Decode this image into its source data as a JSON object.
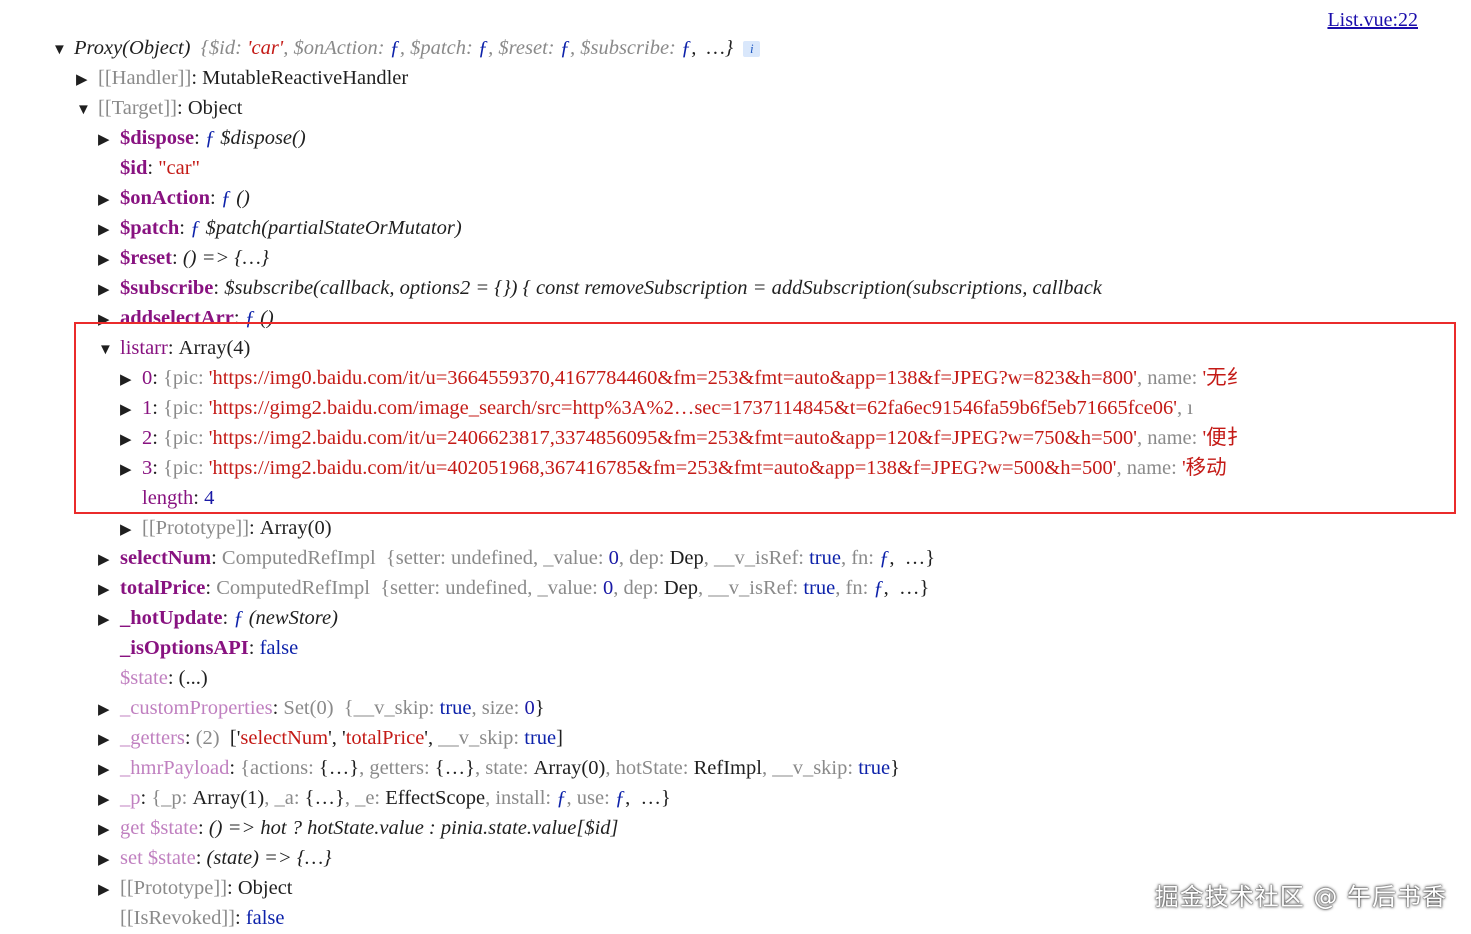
{
  "source_link": "List.vue:22",
  "lines": [
    {
      "caret": "down",
      "parts": [
        {
          "t": "Proxy(Object)",
          "c": "it"
        },
        {
          "t": "  "
        },
        {
          "t": "{$id: ",
          "c": "dim it"
        },
        {
          "t": "'car'",
          "c": "str it"
        },
        {
          "t": ", $onAction: ",
          "c": "dim it"
        },
        {
          "t": "ƒ",
          "c": "fn"
        },
        {
          "t": ", $patch: ",
          "c": "dim it"
        },
        {
          "t": "ƒ",
          "c": "fn"
        },
        {
          "t": ", $reset: ",
          "c": "dim it"
        },
        {
          "t": "ƒ",
          "c": "fn"
        },
        {
          "t": ", $subscribe: ",
          "c": "dim it"
        },
        {
          "t": "ƒ",
          "c": "fn"
        },
        {
          "t": ",  …}",
          "c": "it"
        }
      ],
      "badge": "i"
    },
    {
      "caret": "right",
      "parts": [
        {
          "t": "[[Handler]]",
          "c": "dim"
        },
        {
          "t": ": MutableReactiveHandler"
        }
      ]
    },
    {
      "caret": "down",
      "parts": [
        {
          "t": "[[Target]]",
          "c": "dim"
        },
        {
          "t": ": Object"
        }
      ]
    },
    {
      "caret": "right",
      "parts": [
        {
          "t": "$dispose",
          "c": "key"
        },
        {
          "t": ": "
        },
        {
          "t": "ƒ",
          "c": "fn"
        },
        {
          "t": " $dispose()",
          "c": "it"
        }
      ]
    },
    {
      "caret": "none",
      "parts": [
        {
          "t": "$id",
          "c": "key"
        },
        {
          "t": ": "
        },
        {
          "t": "\"car\"",
          "c": "str"
        }
      ]
    },
    {
      "caret": "right",
      "parts": [
        {
          "t": "$onAction",
          "c": "key"
        },
        {
          "t": ": "
        },
        {
          "t": "ƒ",
          "c": "fn"
        },
        {
          "t": " ()",
          "c": "it"
        }
      ]
    },
    {
      "caret": "right",
      "parts": [
        {
          "t": "$patch",
          "c": "key"
        },
        {
          "t": ": "
        },
        {
          "t": "ƒ",
          "c": "fn"
        },
        {
          "t": " $patch(partialStateOrMutator)",
          "c": "it"
        }
      ]
    },
    {
      "caret": "right",
      "parts": [
        {
          "t": "$reset",
          "c": "key"
        },
        {
          "t": ": "
        },
        {
          "t": "() => {…}",
          "c": "it"
        }
      ]
    },
    {
      "caret": "right",
      "parts": [
        {
          "t": "$subscribe",
          "c": "key"
        },
        {
          "t": ": "
        },
        {
          "t": "$subscribe(callback, options2 = {}) { const removeSubscription = addSubscription(subscriptions, callback",
          "c": "it"
        }
      ]
    },
    {
      "caret": "right",
      "parts": [
        {
          "t": "addselectArr",
          "c": "key"
        },
        {
          "t": ": "
        },
        {
          "t": "ƒ",
          "c": "fn"
        },
        {
          "t": " ()",
          "c": "it"
        }
      ]
    },
    {
      "caret": "down",
      "parts": [
        {
          "t": "listarr",
          "c": "keyp"
        },
        {
          "t": ": Array(4)"
        }
      ]
    },
    {
      "caret": "right",
      "parts": [
        {
          "t": "0",
          "c": "keyp"
        },
        {
          "t": ": "
        },
        {
          "t": "{pic: ",
          "c": "dim"
        },
        {
          "t": "'https://img0.baidu.com/it/u=3664559370,4167784460&fm=253&fmt=auto&app=138&f=JPEG?w=823&h=800'",
          "c": "str"
        },
        {
          "t": ", name: ",
          "c": "dim"
        },
        {
          "t": "'无纟",
          "c": "str"
        }
      ]
    },
    {
      "caret": "right",
      "parts": [
        {
          "t": "1",
          "c": "keyp"
        },
        {
          "t": ": "
        },
        {
          "t": "{pic: ",
          "c": "dim"
        },
        {
          "t": "'https://gimg2.baidu.com/image_search/src=http%3A%2…sec=1737114845&t=62fa6ec91546fa59b6f5eb71665fce06'",
          "c": "str"
        },
        {
          "t": ", ı",
          "c": "dim"
        }
      ]
    },
    {
      "caret": "right",
      "parts": [
        {
          "t": "2",
          "c": "keyp"
        },
        {
          "t": ": "
        },
        {
          "t": "{pic: ",
          "c": "dim"
        },
        {
          "t": "'https://img2.baidu.com/it/u=2406623817,3374856095&fm=253&fmt=auto&app=120&f=JPEG?w=750&h=500'",
          "c": "str"
        },
        {
          "t": ", name: ",
          "c": "dim"
        },
        {
          "t": "'便扌",
          "c": "str"
        }
      ]
    },
    {
      "caret": "right",
      "parts": [
        {
          "t": "3",
          "c": "keyp"
        },
        {
          "t": ": "
        },
        {
          "t": "{pic: ",
          "c": "dim"
        },
        {
          "t": "'https://img2.baidu.com/it/u=402051968,367416785&fm=253&fmt=auto&app=138&f=JPEG?w=500&h=500'",
          "c": "str"
        },
        {
          "t": ", name: ",
          "c": "dim"
        },
        {
          "t": "'移动",
          "c": "str"
        }
      ]
    },
    {
      "caret": "none",
      "parts": [
        {
          "t": "length",
          "c": "keyp"
        },
        {
          "t": ": "
        },
        {
          "t": "4",
          "c": "num"
        }
      ]
    },
    {
      "caret": "right",
      "parts": [
        {
          "t": "[[Prototype]]",
          "c": "dim"
        },
        {
          "t": ": Array(0)"
        }
      ]
    },
    {
      "caret": "right",
      "parts": [
        {
          "t": "selectNum",
          "c": "key"
        },
        {
          "t": ": "
        },
        {
          "t": "ComputedRefImpl",
          "c": "dim"
        },
        {
          "t": "  "
        },
        {
          "t": "{setter: ",
          "c": "dim"
        },
        {
          "t": "undefined",
          "c": "dim"
        },
        {
          "t": ", _value: ",
          "c": "dim"
        },
        {
          "t": "0",
          "c": "num"
        },
        {
          "t": ", dep: ",
          "c": "dim"
        },
        {
          "t": "Dep"
        },
        {
          "t": ", __v_isRef: ",
          "c": "dim"
        },
        {
          "t": "true",
          "c": "kw"
        },
        {
          "t": ", fn: ",
          "c": "dim"
        },
        {
          "t": "ƒ",
          "c": "fn"
        },
        {
          "t": ",  …}"
        }
      ]
    },
    {
      "caret": "right",
      "parts": [
        {
          "t": "totalPrice",
          "c": "key"
        },
        {
          "t": ": "
        },
        {
          "t": "ComputedRefImpl",
          "c": "dim"
        },
        {
          "t": "  "
        },
        {
          "t": "{setter: ",
          "c": "dim"
        },
        {
          "t": "undefined",
          "c": "dim"
        },
        {
          "t": ", _value: ",
          "c": "dim"
        },
        {
          "t": "0",
          "c": "num"
        },
        {
          "t": ", dep: ",
          "c": "dim"
        },
        {
          "t": "Dep"
        },
        {
          "t": ", __v_isRef: ",
          "c": "dim"
        },
        {
          "t": "true",
          "c": "kw"
        },
        {
          "t": ", fn: ",
          "c": "dim"
        },
        {
          "t": "ƒ",
          "c": "fn"
        },
        {
          "t": ",  …}"
        }
      ]
    },
    {
      "caret": "right",
      "parts": [
        {
          "t": "_hotUpdate",
          "c": "key"
        },
        {
          "t": ": "
        },
        {
          "t": "ƒ",
          "c": "fn"
        },
        {
          "t": " (newStore)",
          "c": "it"
        }
      ]
    },
    {
      "caret": "none",
      "parts": [
        {
          "t": "_isOptionsAPI",
          "c": "key"
        },
        {
          "t": ": "
        },
        {
          "t": "false",
          "c": "kw"
        }
      ]
    },
    {
      "caret": "none",
      "parts": [
        {
          "t": "$state",
          "c": "keydim"
        },
        {
          "t": ": (...)"
        }
      ]
    },
    {
      "caret": "right",
      "parts": [
        {
          "t": "_customProperties",
          "c": "keydim"
        },
        {
          "t": ": "
        },
        {
          "t": "Set(0)",
          "c": "dim"
        },
        {
          "t": "  "
        },
        {
          "t": "{__v_skip: ",
          "c": "dim"
        },
        {
          "t": "true",
          "c": "kw"
        },
        {
          "t": ", size: ",
          "c": "dim"
        },
        {
          "t": "0",
          "c": "num"
        },
        {
          "t": "}"
        }
      ]
    },
    {
      "caret": "right",
      "parts": [
        {
          "t": "_getters",
          "c": "keydim"
        },
        {
          "t": ": "
        },
        {
          "t": "(2)",
          "c": "dim"
        },
        {
          "t": "  ['"
        },
        {
          "t": "selectNum",
          "c": "str"
        },
        {
          "t": "', '"
        },
        {
          "t": "totalPrice",
          "c": "str"
        },
        {
          "t": "', "
        },
        {
          "t": "__v_skip: ",
          "c": "dim"
        },
        {
          "t": "true",
          "c": "kw"
        },
        {
          "t": "]"
        }
      ]
    },
    {
      "caret": "right",
      "parts": [
        {
          "t": "_hmrPayload",
          "c": "keydim"
        },
        {
          "t": ": "
        },
        {
          "t": "{actions: ",
          "c": "dim"
        },
        {
          "t": "{…}"
        },
        {
          "t": ", getters: ",
          "c": "dim"
        },
        {
          "t": "{…}"
        },
        {
          "t": ", state: ",
          "c": "dim"
        },
        {
          "t": "Array(0)"
        },
        {
          "t": ", hotState: ",
          "c": "dim"
        },
        {
          "t": "RefImpl"
        },
        {
          "t": ", __v_skip: ",
          "c": "dim"
        },
        {
          "t": "true",
          "c": "kw"
        },
        {
          "t": "}"
        }
      ]
    },
    {
      "caret": "right",
      "parts": [
        {
          "t": "_p",
          "c": "keydim"
        },
        {
          "t": ": "
        },
        {
          "t": "{_p: ",
          "c": "dim"
        },
        {
          "t": "Array(1)"
        },
        {
          "t": ", _a: ",
          "c": "dim"
        },
        {
          "t": "{…}"
        },
        {
          "t": ", _e: ",
          "c": "dim"
        },
        {
          "t": "EffectScope"
        },
        {
          "t": ", install: ",
          "c": "dim"
        },
        {
          "t": "ƒ",
          "c": "fn"
        },
        {
          "t": ", use: ",
          "c": "dim"
        },
        {
          "t": "ƒ",
          "c": "fn"
        },
        {
          "t": ",  …}"
        }
      ]
    },
    {
      "caret": "right",
      "parts": [
        {
          "t": "get $state",
          "c": "keydim"
        },
        {
          "t": ": "
        },
        {
          "t": "() => hot ? hotState.value : pinia.state.value[$id]",
          "c": "it"
        }
      ]
    },
    {
      "caret": "right",
      "parts": [
        {
          "t": "set $state",
          "c": "keydim"
        },
        {
          "t": ": "
        },
        {
          "t": "(state) => {…}",
          "c": "it"
        }
      ]
    },
    {
      "caret": "right",
      "parts": [
        {
          "t": "[[Prototype]]",
          "c": "dim"
        },
        {
          "t": ": Object"
        }
      ]
    },
    {
      "caret": "none",
      "parts": [
        {
          "t": "[[IsRevoked]]",
          "c": "dim"
        },
        {
          "t": ": "
        },
        {
          "t": "false",
          "c": "kw"
        }
      ]
    }
  ],
  "watermark": "掘金技术社区 @ 午后书香"
}
